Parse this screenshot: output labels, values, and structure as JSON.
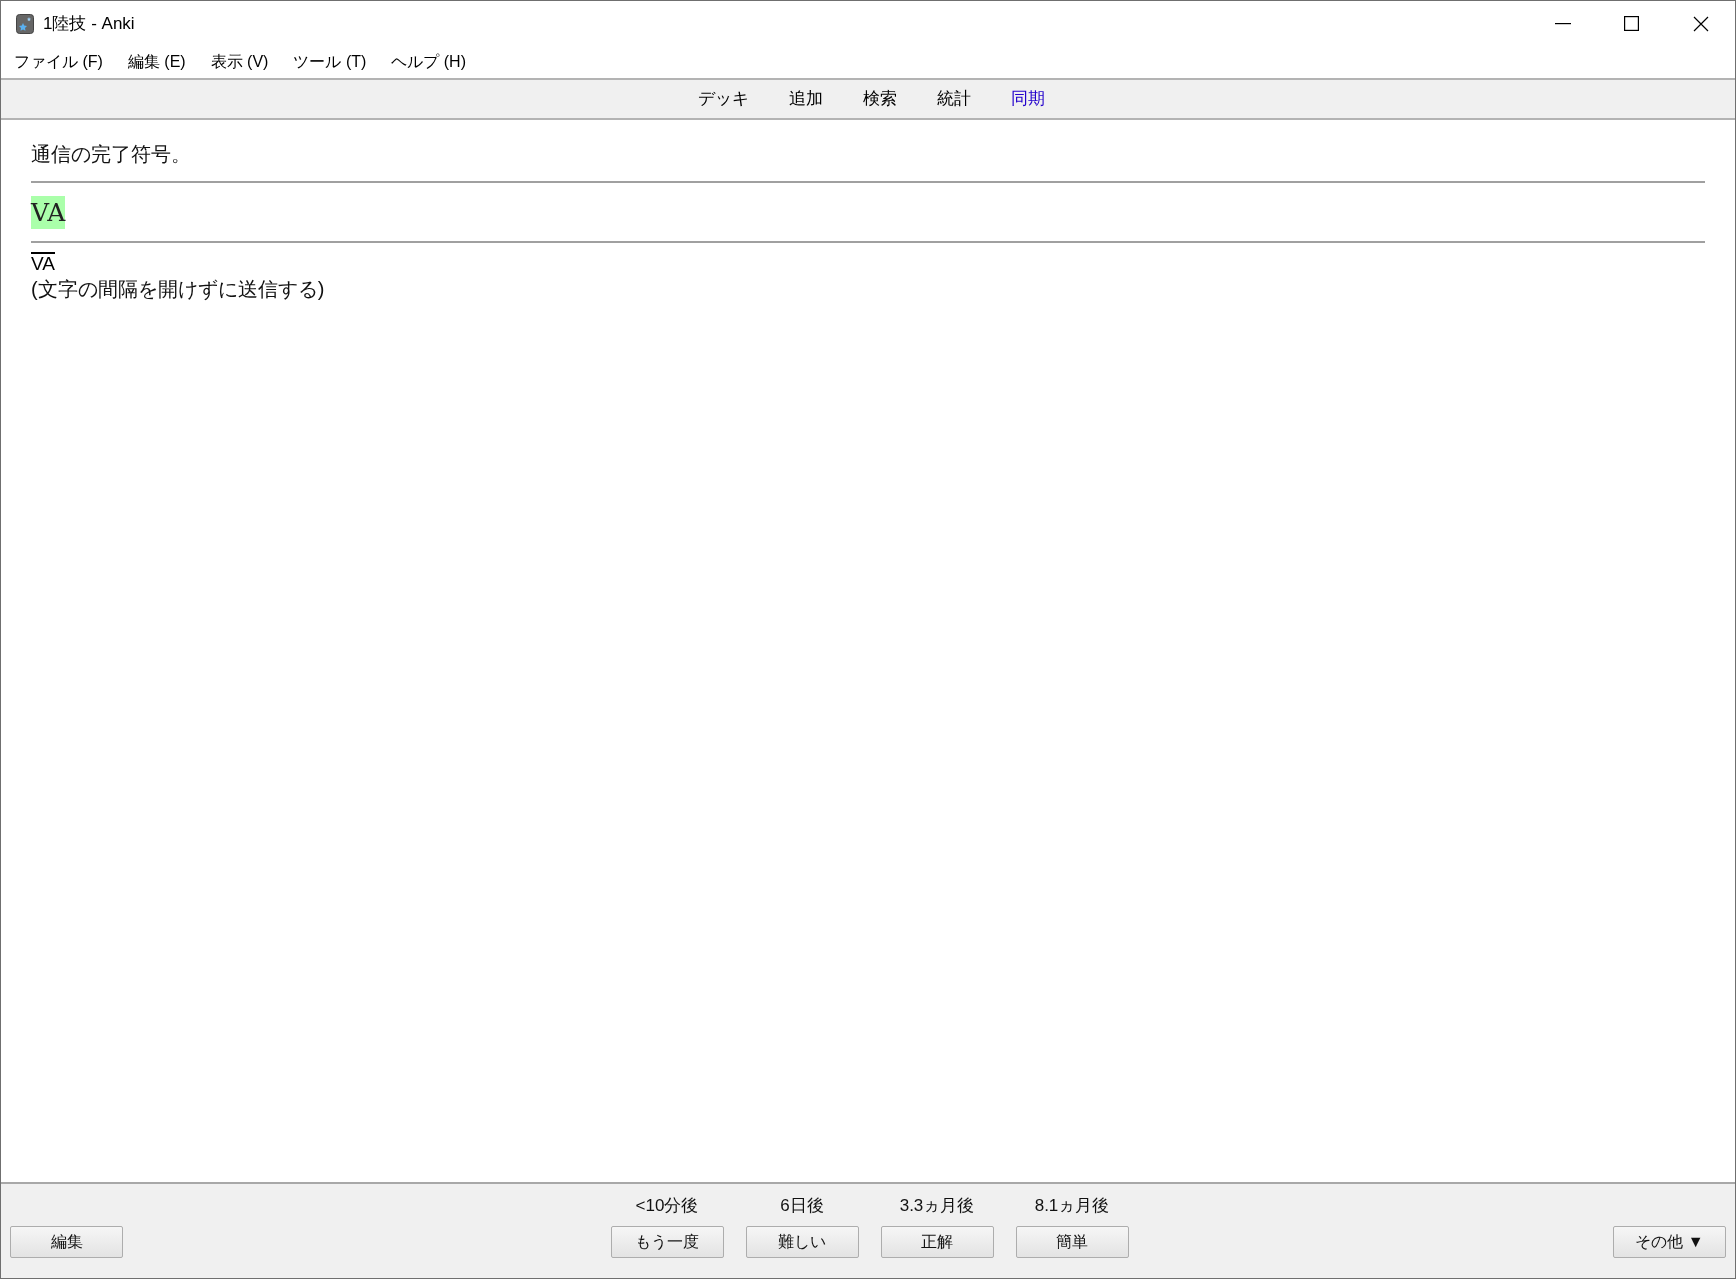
{
  "window": {
    "title": "1陸技 - Anki"
  },
  "menu": [
    "ファイル (F)",
    "編集 (E)",
    "表示 (V)",
    "ツール (T)",
    "ヘルプ (H)"
  ],
  "toolbar": [
    {
      "label": "デッキ",
      "highlighted": false
    },
    {
      "label": "追加",
      "highlighted": false
    },
    {
      "label": "検索",
      "highlighted": false
    },
    {
      "label": "統計",
      "highlighted": false
    },
    {
      "label": "同期",
      "highlighted": true
    }
  ],
  "card": {
    "question": "通信の完了符号。",
    "answer": {
      "text": "VA",
      "highlighted": true
    },
    "code": {
      "text": "VA",
      "overline": true
    },
    "note": "(文字の間隔を開けずに送信する)"
  },
  "bottom_bar": {
    "edit_button": "編集",
    "answers": [
      {
        "interval": "<10分後",
        "button": "もう一度"
      },
      {
        "interval": "6日後",
        "button": "難しい"
      },
      {
        "interval": "3.3ヵ月後",
        "button": "正解"
      },
      {
        "interval": "8.1ヵ月後",
        "button": "簡単"
      }
    ],
    "more_button": "その他 ▼"
  }
}
